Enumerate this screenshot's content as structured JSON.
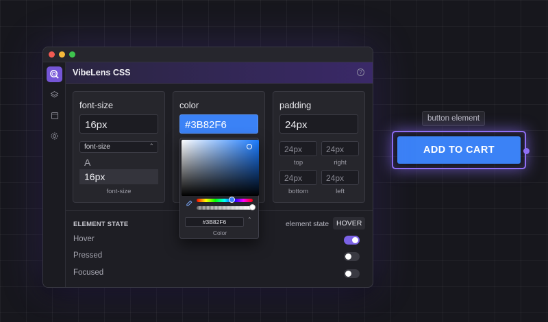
{
  "app": {
    "title": "VibeLens CSS",
    "help_icon": "?"
  },
  "sidebar": {
    "icons": [
      "search-icon",
      "layers-icon",
      "square-icon",
      "gear-icon"
    ],
    "active": "search-icon"
  },
  "font_size_card": {
    "title": "font-size",
    "value": "16px",
    "select_value": "font-size",
    "options": [
      "A",
      "16px"
    ],
    "caption": "font-size"
  },
  "color_card": {
    "title": "color",
    "value": "#3B82F6",
    "picker": {
      "hex": "#3B82F6",
      "caption": "Color"
    }
  },
  "padding_card": {
    "title": "padding",
    "value": "24px",
    "sides": [
      {
        "value": "24px",
        "label": "top"
      },
      {
        "value": "24px",
        "label": "right"
      },
      {
        "value": "24px",
        "label": "bottom"
      },
      {
        "value": "24px",
        "label": "left"
      }
    ]
  },
  "element_state": {
    "title": "ELEMENT STATE",
    "label": "element state",
    "badge": "HOVER",
    "states": [
      {
        "label": "Hover",
        "on": true
      },
      {
        "label": "Pressed",
        "on": false
      },
      {
        "label": "Focused",
        "on": false
      }
    ]
  },
  "preview": {
    "tooltip": "button element",
    "button_label": "ADD TO CART",
    "button_color": "#3B82F6",
    "selection_color": "#8F6FF5"
  }
}
